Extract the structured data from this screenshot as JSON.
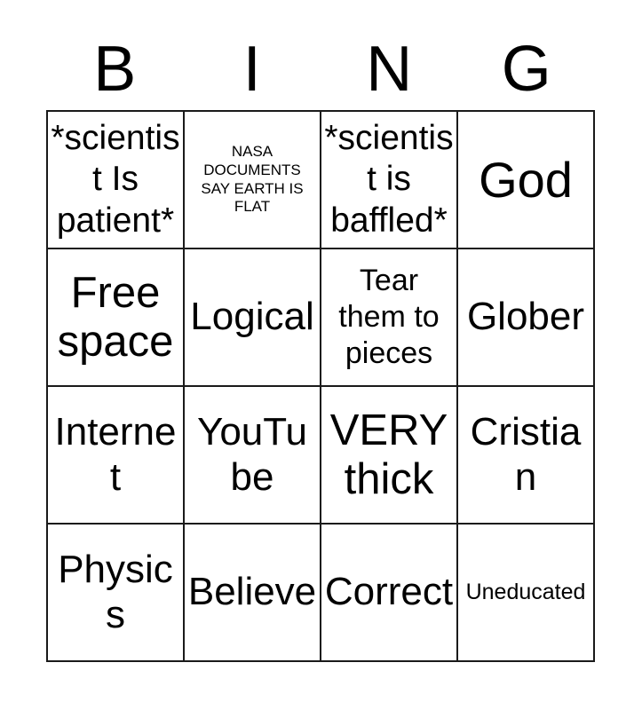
{
  "card": {
    "title_letters": [
      "B",
      "I",
      "N",
      "G"
    ],
    "columns": 4,
    "rows": 4,
    "border_color": "#1a1a1a",
    "background_color": "#ffffff",
    "text_color": "#000000"
  },
  "cells": [
    {
      "text": "*scientist Is patient*",
      "size": "lg"
    },
    {
      "text": "NASA DOCUMENTS SAY EARTH IS FLAT",
      "size": "xs"
    },
    {
      "text": "*scientist is baffled*",
      "size": "lg"
    },
    {
      "text": "God",
      "size": "3xl"
    },
    {
      "text": "Free space",
      "size": "2xl"
    },
    {
      "text": "Logical",
      "size": "xl"
    },
    {
      "text": "Tear them to pieces",
      "size": "md"
    },
    {
      "text": "Glober",
      "size": "xl"
    },
    {
      "text": "Internet",
      "size": "xl"
    },
    {
      "text": "YouTube",
      "size": "xl"
    },
    {
      "text": "VERY thick",
      "size": "2xl"
    },
    {
      "text": "Cristian",
      "size": "xl"
    },
    {
      "text": "Physics",
      "size": "xl"
    },
    {
      "text": "Believe",
      "size": "xl"
    },
    {
      "text": "Correct",
      "size": "xl"
    },
    {
      "text": "Uneducated",
      "size": "sm"
    }
  ]
}
